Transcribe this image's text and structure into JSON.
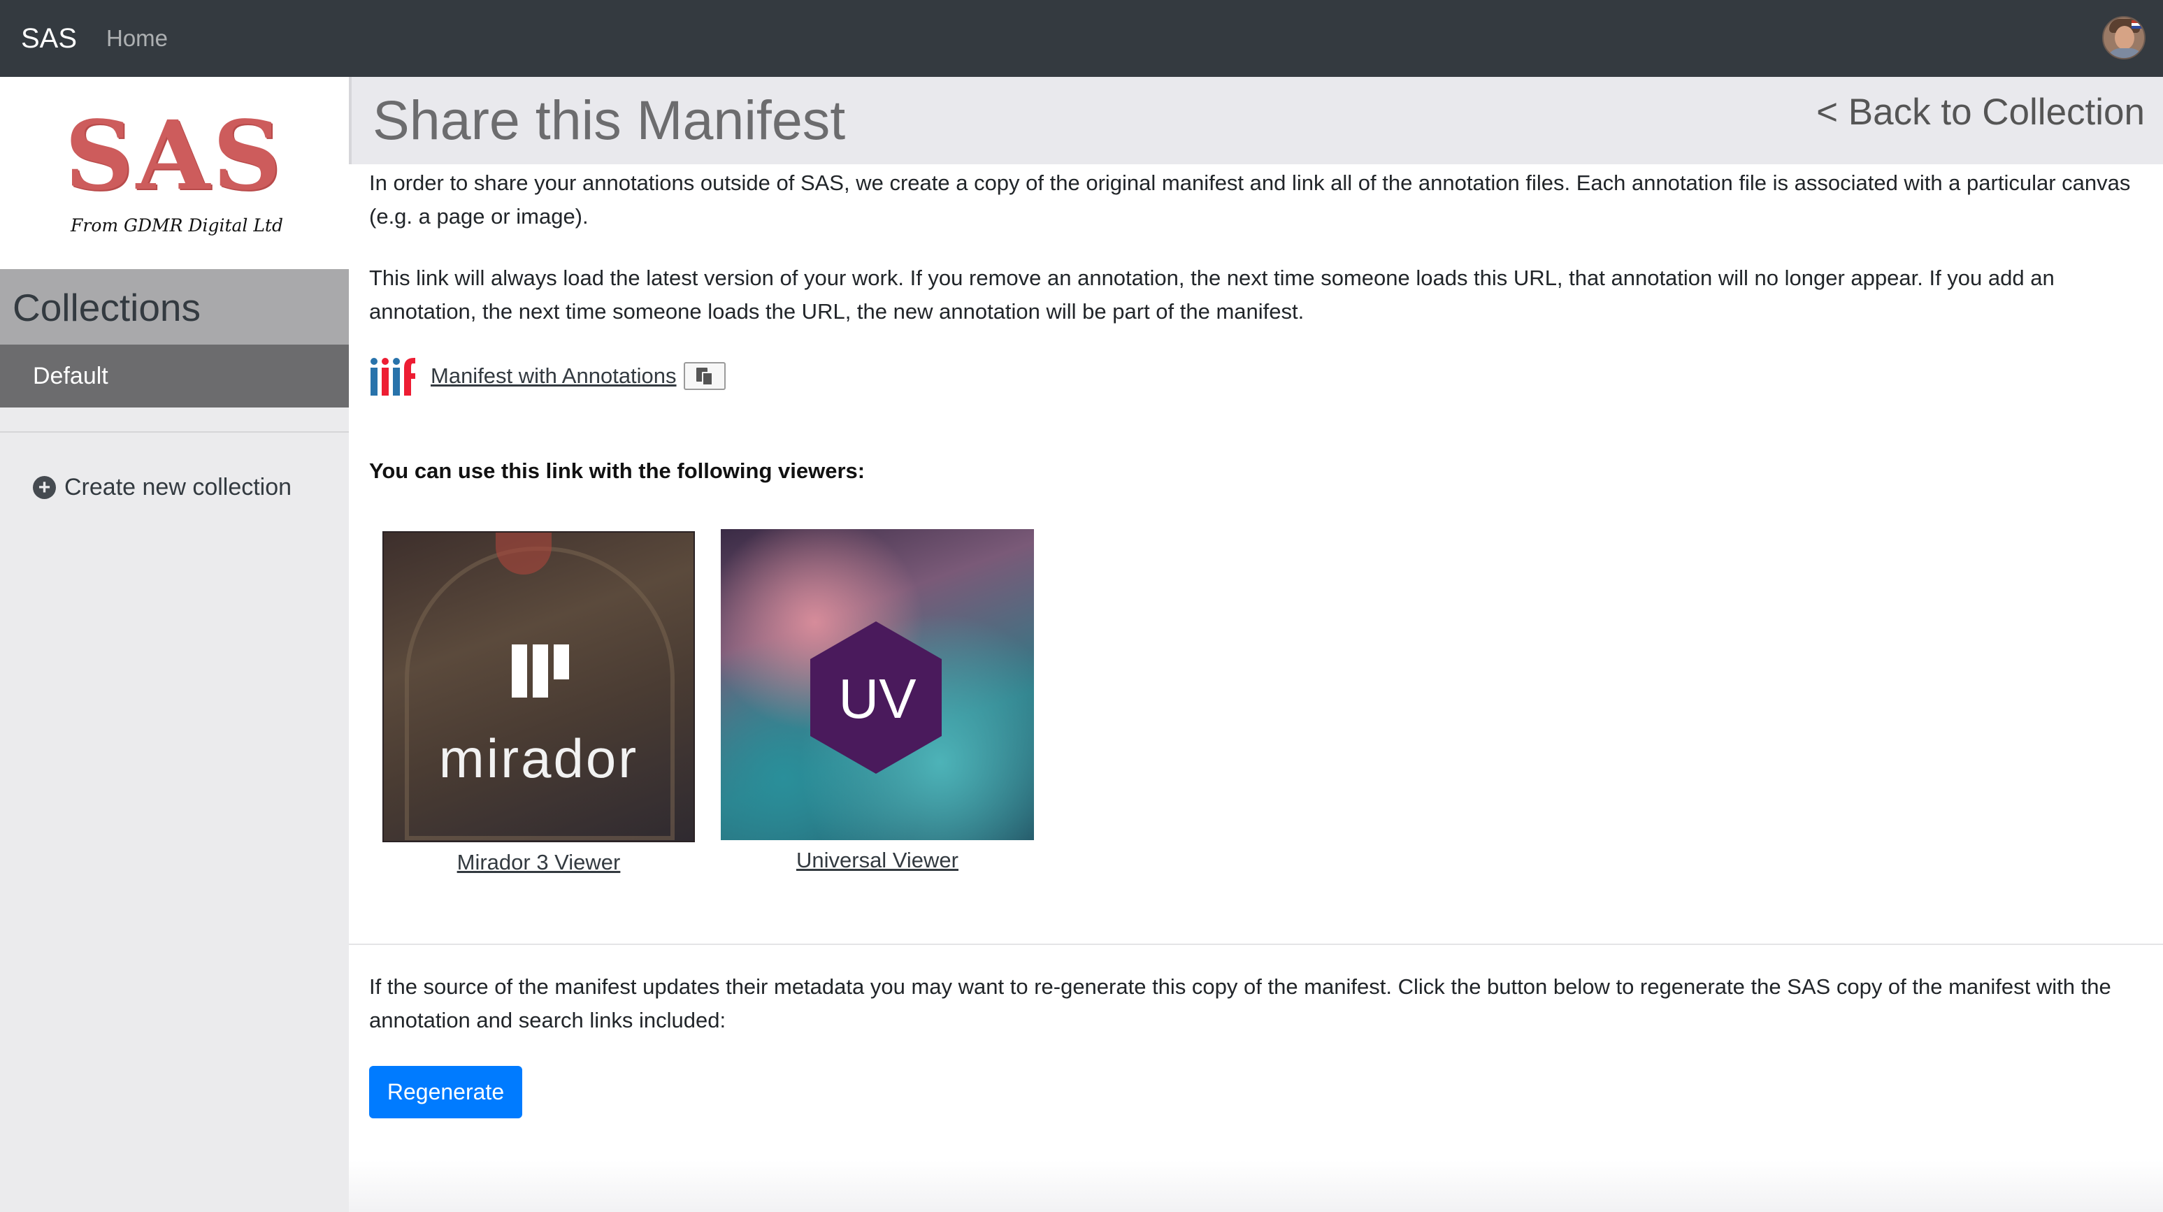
{
  "navbar": {
    "brand": "SAS",
    "home": "Home"
  },
  "sidebar": {
    "logo_text": "SAS",
    "logo_subtitle": "From GDMR Digital Ltd",
    "collections_title": "Collections",
    "items": [
      {
        "label": "Default",
        "active": true
      }
    ],
    "create_label": "Create new collection"
  },
  "header": {
    "title": "Share this Manifest",
    "back_link": "< Back to Collection"
  },
  "content": {
    "intro": "In order to share your annotations outside of SAS, we create a copy of the original manifest and link all of the annotation files. Each annotation file is associated with a particular canvas (e.g. a page or image).",
    "latest": "This link will always load the latest version of your work. If you remove an annotation, the next time someone loads this URL, that annotation will no longer appear. If you add an annotation, the next time someone loads the URL, the new annotation will be part of the manifest.",
    "manifest_link": "Manifest with Annotations",
    "viewers_heading": "You can use this link with the following viewers:",
    "viewers": [
      {
        "name": "Mirador 3 Viewer",
        "logo_text": "mirador"
      },
      {
        "name": "Universal Viewer",
        "logo_text": "UV"
      }
    ],
    "regenerate_text": "If the source of the manifest updates their metadata you may want to re-generate this copy of the manifest. Click the button below to regenerate the SAS copy of the manifest with the annotation and search links included:",
    "regenerate_button": "Regenerate"
  },
  "colors": {
    "navbar": "#343a40",
    "sidebar": "#ebebed",
    "logo": "#cd5c5c",
    "primary": "#007bff",
    "uv_hex": "#4a1a5c"
  },
  "icons": [
    "user-avatar-icon",
    "plus-circle-icon",
    "iiif-logo-icon",
    "copy-icon"
  ]
}
